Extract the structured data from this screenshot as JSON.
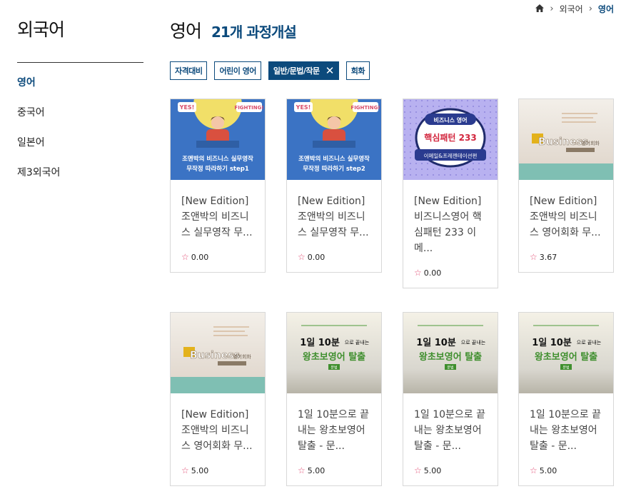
{
  "sidebar": {
    "title": "외국어",
    "items": [
      {
        "label": "영어",
        "active": true
      },
      {
        "label": "중국어",
        "active": false
      },
      {
        "label": "일본어",
        "active": false
      },
      {
        "label": "제3외국어",
        "active": false
      }
    ]
  },
  "breadcrumb": {
    "home_icon": "home-icon",
    "items": [
      "외국어",
      "영어"
    ]
  },
  "header": {
    "title": "영어",
    "count": "21개 과정개설"
  },
  "filters": [
    {
      "label": "자격대비",
      "active": false
    },
    {
      "label": "어린이 영어",
      "active": false
    },
    {
      "label": "일반/문법/작문",
      "active": true,
      "remove_icon": "close-icon"
    },
    {
      "label": "회화",
      "active": false
    }
  ],
  "accent_color": "#0c4a7c",
  "courses": [
    {
      "name": "[New Edition] 조앤박의 비즈니스 실무영작 무...",
      "rating": "0.00",
      "thumb": {
        "style": "blue",
        "badge1": "YES!",
        "badge2": "FIGHTING!",
        "line1": "조앤박의 비즈니스 실무영작",
        "line2": "무작정 따라하기 step1"
      }
    },
    {
      "name": "[New Edition] 조앤박의 비즈니스 실무영작 무...",
      "rating": "0.00",
      "thumb": {
        "style": "blue",
        "badge1": "YES!",
        "badge2": "FIGHTING!",
        "line1": "조앤박의 비즈니스 실무영작",
        "line2": "무작정 따라하기 step2"
      }
    },
    {
      "name": "[New Edition] 비즈니스영어 핵심패턴 233 이메...",
      "rating": "0.00",
      "thumb": {
        "style": "badge",
        "line1": "비즈니스 영어",
        "line2": "핵심패턴 233",
        "line3": "이메일&프레젠테이션편"
      }
    },
    {
      "name": "[New Edition] 조앤박의 비즈니스 영어회화 무...",
      "rating": "3.67",
      "thumb": {
        "style": "business",
        "line1": "Business",
        "line2": "영어회화"
      }
    },
    {
      "name": "[New Edition] 조앤박의 비즈니스 영어회화 무...",
      "rating": "5.00",
      "thumb": {
        "style": "business",
        "line1": "Business",
        "line2": "영어회화"
      }
    },
    {
      "name": "1일 10분으로 끝내는 왕초보영어 탈출 - 문...",
      "rating": "5.00",
      "thumb": {
        "style": "chobo",
        "line1": "1일 10분",
        "line1b": "으로 끝내는",
        "line2": "왕초보영어 탈출",
        "tag": "문법"
      }
    },
    {
      "name": "1일 10분으로 끝내는 왕초보영어 탈출 - 문...",
      "rating": "5.00",
      "thumb": {
        "style": "chobo",
        "line1": "1일 10분",
        "line1b": "으로 끝내는",
        "line2": "왕초보영어 탈출",
        "tag": "문법"
      }
    },
    {
      "name": "1일 10분으로 끝내는 왕초보영어 탈출 - 문...",
      "rating": "5.00",
      "thumb": {
        "style": "chobo",
        "line1": "1일 10분",
        "line1b": "으로 끝내는",
        "line2": "왕초보영어 탈출",
        "tag": "문법"
      }
    }
  ]
}
